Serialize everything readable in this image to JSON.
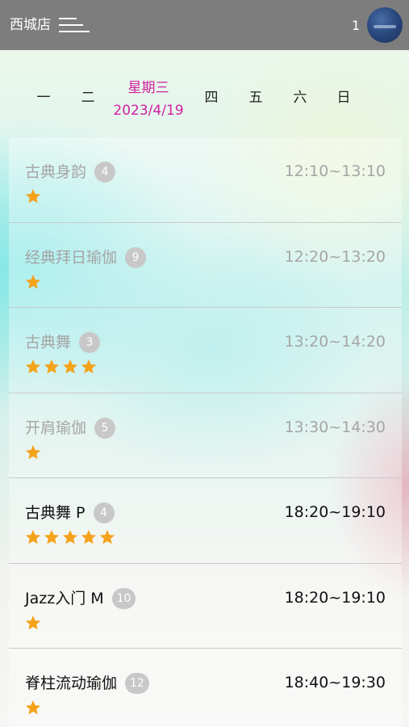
{
  "header": {
    "store_name": "西城店",
    "count": "1"
  },
  "week": {
    "days": [
      "一",
      "二",
      "星期三",
      "四",
      "五",
      "六",
      "日"
    ],
    "active_index": 2,
    "active_date": "2023/4/19",
    "active_color": "#d21f9e"
  },
  "classes": [
    {
      "name": "古典身韵",
      "booked": "4",
      "time": "12:10~13:10",
      "rating": 1,
      "status": "past"
    },
    {
      "name": "经典拜日瑜伽",
      "booked": "9",
      "time": "12:20~13:20",
      "rating": 1,
      "status": "past"
    },
    {
      "name": "古典舞",
      "booked": "3",
      "time": "13:20~14:20",
      "rating": 4,
      "status": "past"
    },
    {
      "name": "开肩瑜伽",
      "booked": "5",
      "time": "13:30~14:30",
      "rating": 1,
      "status": "past"
    },
    {
      "name": "古典舞 P",
      "booked": "4",
      "time": "18:20~19:10",
      "rating": 5,
      "status": "future"
    },
    {
      "name": "Jazz入门 M",
      "booked": "10",
      "time": "18:20~19:10",
      "rating": 1,
      "status": "future"
    },
    {
      "name": "脊柱流动瑜伽",
      "booked": "12",
      "time": "18:40~19:30",
      "rating": 1,
      "status": "future"
    }
  ],
  "colors": {
    "header_bg": "#7d7d7d",
    "star": "#f5a21b",
    "badge": "#c8c8c8",
    "past_text": "#a5a5a5"
  },
  "icons": {
    "menu": "hamburger-menu-icon",
    "star": "star-icon",
    "avatar": "user-avatar"
  }
}
